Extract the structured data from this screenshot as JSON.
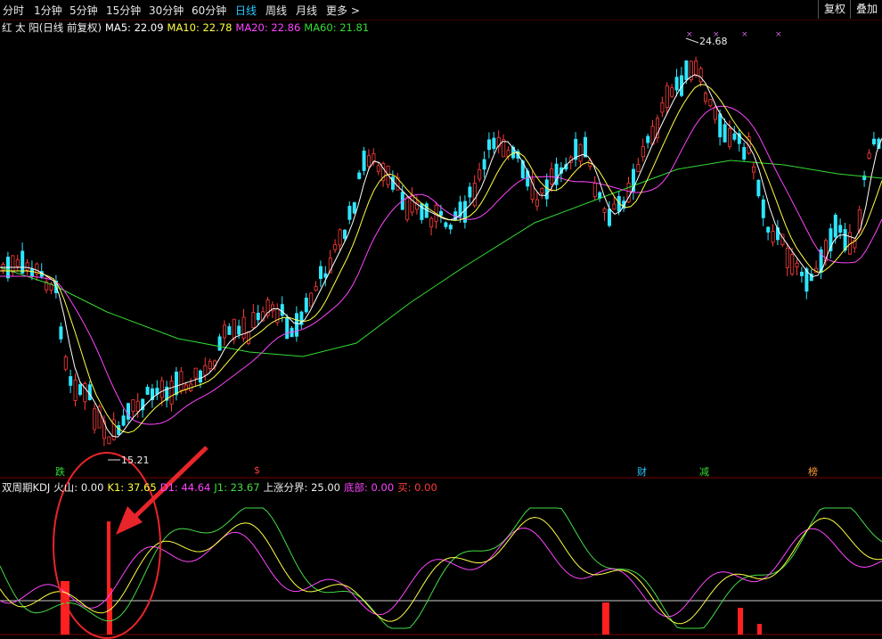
{
  "toolbar": {
    "timeframes": [
      "分时",
      "1分钟",
      "5分钟",
      "15分钟",
      "30分钟",
      "60分钟",
      "日线",
      "周线",
      "月线",
      "更多 >"
    ],
    "active": "日线",
    "restore_label": "复权",
    "overlay_label": "叠加"
  },
  "main_legend": {
    "name": "红 太 阳(日线 前复权)",
    "ma5": "MA5: 22.09",
    "ma10": "MA10: 22.78",
    "ma20": "MA20: 22.86",
    "ma60": "MA60: 21.81"
  },
  "price_markers": {
    "high": "24.68",
    "low": "15.21"
  },
  "event_tags": {
    "die": "跌",
    "dollar": "$",
    "cai": "财",
    "jian": "减",
    "bang": "榜"
  },
  "kdj_legend": {
    "name": "双周期KDJ",
    "volcano": "火山: 0.00",
    "k1": "K1: 37.65",
    "d1": "D1: 44.64",
    "j1": "J1: 23.67",
    "rise_bound": "上涨分界: 25.00",
    "bottom": "底部: 0.00",
    "buy": "买: 0.00"
  },
  "colors": {
    "up": "#ff3b3b",
    "down": "#2ee6ff",
    "ma5": "#ffffff",
    "ma10": "#ffff44",
    "ma20": "#ff44ff",
    "ma60": "#33dd33",
    "accent": "#29c7ff",
    "annotation": "#e8252a"
  },
  "chart_data": {
    "type": "line",
    "price_range": [
      15.21,
      24.68
    ],
    "series": [
      {
        "name": "MA5",
        "values": [
          22.09
        ]
      },
      {
        "name": "MA10",
        "values": [
          22.78
        ]
      },
      {
        "name": "MA20",
        "values": [
          22.86
        ]
      },
      {
        "name": "MA60",
        "values": [
          21.81
        ]
      }
    ]
  }
}
